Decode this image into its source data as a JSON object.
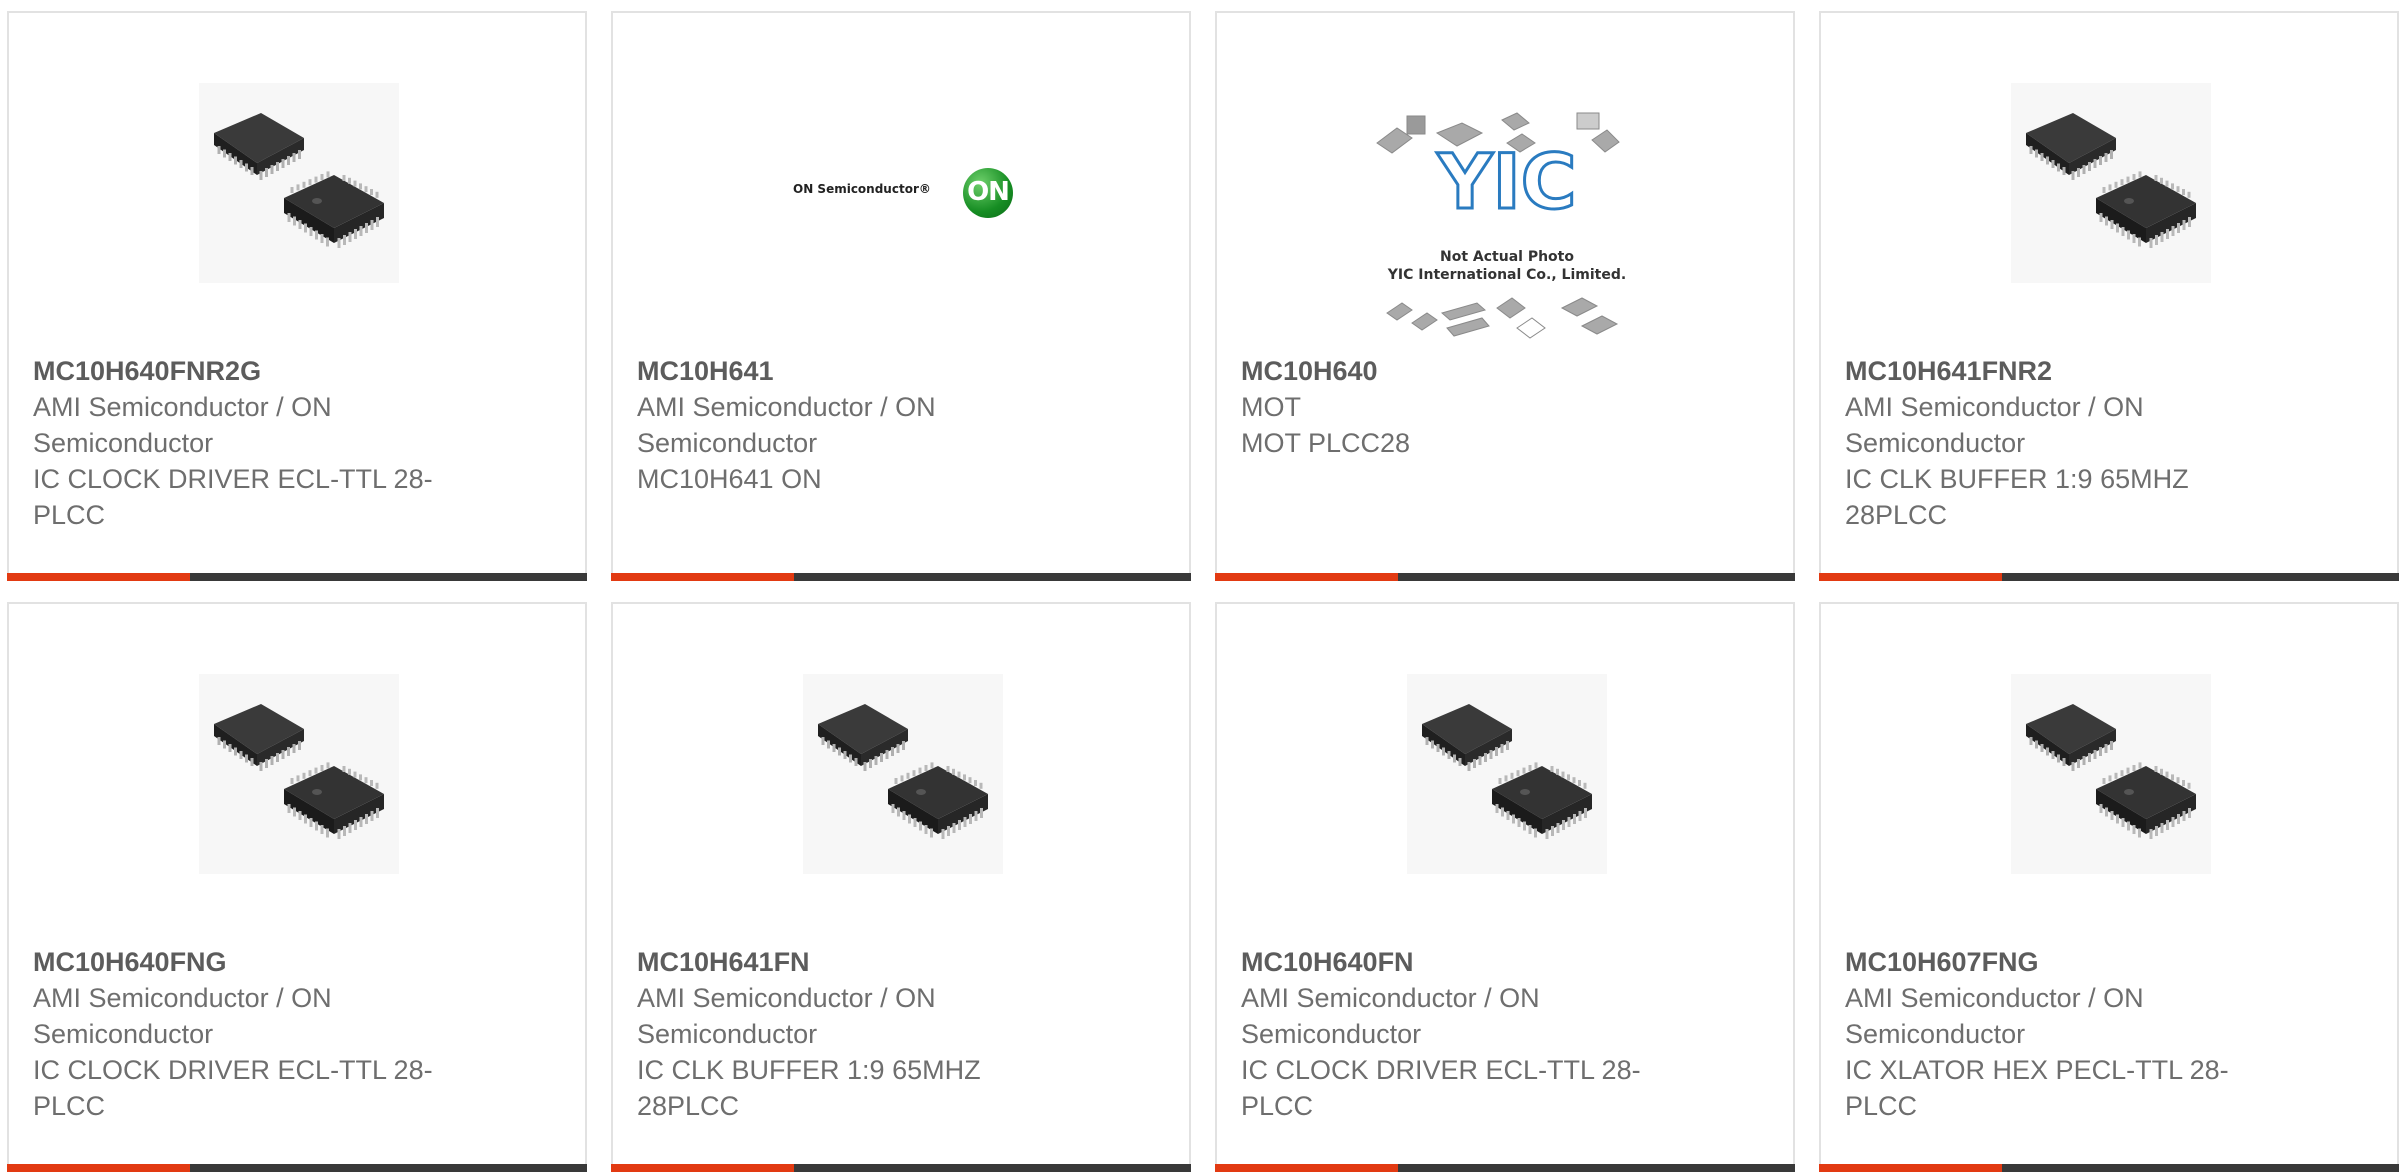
{
  "products": [
    {
      "part": "MC10H640FNR2G",
      "manufacturer": "AMI Semiconductor / ON Semiconductor",
      "description": "IC CLOCK DRIVER ECL-TTL 28-PLCC",
      "image": "plcc-chip-photo"
    },
    {
      "part": "MC10H641",
      "manufacturer": "AMI Semiconductor / ON Semiconductor",
      "description": "MC10H641 ON",
      "image": "on-semiconductor-logo"
    },
    {
      "part": "MC10H640",
      "manufacturer": "MOT",
      "description": "MOT PLCC28",
      "image": "yic-placeholder"
    },
    {
      "part": "MC10H641FNR2",
      "manufacturer": "AMI Semiconductor / ON Semiconductor",
      "description": "IC CLK BUFFER 1:9 65MHZ 28PLCC",
      "image": "plcc-chip-photo"
    },
    {
      "part": "MC10H640FNG",
      "manufacturer": "AMI Semiconductor / ON Semiconductor",
      "description": "IC CLOCK DRIVER ECL-TTL 28-PLCC",
      "image": "plcc-chip-photo"
    },
    {
      "part": "MC10H641FN",
      "manufacturer": "AMI Semiconductor / ON Semiconductor",
      "description": "IC CLK BUFFER 1:9 65MHZ 28PLCC",
      "image": "plcc-chip-photo"
    },
    {
      "part": "MC10H640FN",
      "manufacturer": "AMI Semiconductor / ON Semiconductor",
      "description": "IC CLOCK DRIVER ECL-TTL 28-PLCC",
      "image": "plcc-chip-photo"
    },
    {
      "part": "MC10H607FNG",
      "manufacturer": "AMI Semiconductor / ON Semiconductor",
      "description": "IC XLATOR HEX PECL-TTL 28-PLCC",
      "image": "plcc-chip-photo"
    }
  ],
  "logos": {
    "on_text": "ON Semiconductor®",
    "on_mark": "ON",
    "yic_mark": "YIC",
    "yic_line1": "Not Actual Photo",
    "yic_line2": "YIC International Co., Limited."
  },
  "colors": {
    "accent": "#e23a12",
    "bar": "#393939",
    "border": "#e2e2e2",
    "text": "#666666"
  }
}
